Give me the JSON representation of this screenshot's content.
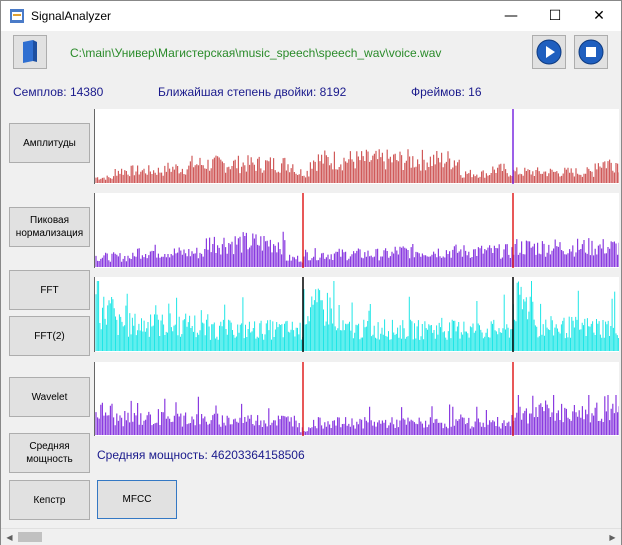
{
  "window": {
    "title": "SignalAnalyzer",
    "minimize_glyph": "—",
    "maximize_glyph": "☐",
    "close_glyph": "✕"
  },
  "file": {
    "path": "C:\\main\\Универ\\Магистерская\\music_speech\\speech_wav\\voice.wav"
  },
  "stats": {
    "samples_label": "Семплов: 14380",
    "nearest_pow2_label": "Ближайшая степень двойки: 8192",
    "frames_label": "Фреймов: 16"
  },
  "buttons": {
    "amplitudes": "Амплитуды",
    "peak_norm": "Пиковая нормализация",
    "fft": "FFT",
    "fft2": "FFT(2)",
    "wavelet": "Wavelet",
    "avg_power": "Средняя мощность",
    "cepstrum": "Кепстр",
    "mfcc": "MFCC"
  },
  "avg_power": {
    "label": "Средняя мощность: 46203364158506"
  },
  "colors": {
    "amplitude": "#d05a5a",
    "normalized": "#8a3be0",
    "fft": "#1ee6e6",
    "wavelet": "#8a3be0",
    "marker_red": "#e02020",
    "marker_purple": "#7a2be0",
    "play_blue": "#1f5fbf"
  },
  "icons": {
    "folder": "folder-icon",
    "play": "play-icon",
    "stop": "stop-icon"
  }
}
